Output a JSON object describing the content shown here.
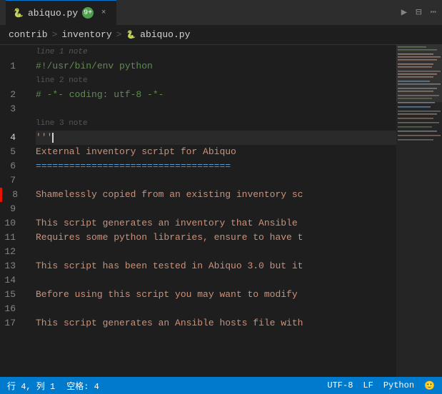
{
  "titleBar": {
    "tab": {
      "icon": "🐍",
      "name": "abiquo.py",
      "badge": "9+",
      "closeIcon": "×"
    },
    "actions": {
      "play": "▶",
      "split": "⊟",
      "more": "⋯"
    }
  },
  "breadcrumb": {
    "items": [
      "contrib",
      "inventory",
      "abiquo.py"
    ],
    "separators": [
      ">",
      ">"
    ]
  },
  "lines": [
    {
      "num": "",
      "note": "line 1 note",
      "isNote": true
    },
    {
      "num": "1",
      "code": "#!/usr/bin/env python",
      "type": "shebang"
    },
    {
      "num": "",
      "note": "line 2 note",
      "isNote": true
    },
    {
      "num": "2",
      "code": "# -*- coding: utf-8 -*-",
      "type": "comment"
    },
    {
      "num": "3",
      "code": "",
      "type": "empty"
    },
    {
      "num": "",
      "note": "line 3 note",
      "isNote": true
    },
    {
      "num": "4",
      "code": "'''",
      "type": "string",
      "active": true
    },
    {
      "num": "5",
      "code": "External inventory script for Abiquo",
      "type": "string"
    },
    {
      "num": "6",
      "code": "===================================",
      "type": "string"
    },
    {
      "num": "7",
      "code": "",
      "type": "string"
    },
    {
      "num": "8",
      "code": "Shamelessly copied from an existing inventory sc",
      "type": "string"
    },
    {
      "num": "9",
      "code": "",
      "type": "string"
    },
    {
      "num": "10",
      "code": "This script generates an inventory that Ansible",
      "type": "string"
    },
    {
      "num": "11",
      "code": "Requires some python libraries, ensure to have t",
      "type": "string"
    },
    {
      "num": "12",
      "code": "",
      "type": "string"
    },
    {
      "num": "13",
      "code": "This script has been tested in Abiquo 3.0 but it",
      "type": "string"
    },
    {
      "num": "14",
      "code": "",
      "type": "string"
    },
    {
      "num": "15",
      "code": "Before using this script you may want to modify",
      "type": "string"
    },
    {
      "num": "16",
      "code": "",
      "type": "string"
    },
    {
      "num": "17",
      "code": "This script generates an Ansible hosts file with",
      "type": "string"
    }
  ],
  "statusBar": {
    "position": "行 4, 列 1",
    "spaces": "空格: 4",
    "encoding": "UTF-8",
    "lineEnding": "LF",
    "language": "Python",
    "feedback": "🙂"
  }
}
